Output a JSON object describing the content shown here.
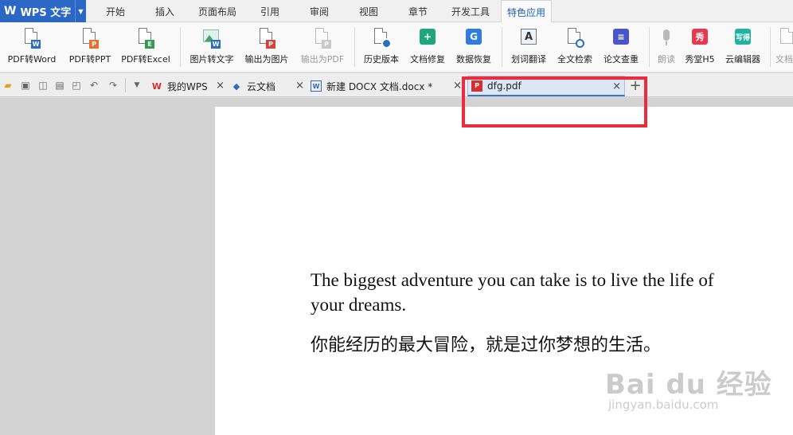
{
  "app": {
    "title": "WPS 文字"
  },
  "menu_tabs": [
    "开始",
    "插入",
    "页面布局",
    "引用",
    "审阅",
    "视图",
    "章节",
    "开发工具",
    "特色应用"
  ],
  "ribbon": {
    "buttons": [
      {
        "label": "PDF转Word",
        "icon": "pdf-to-word-icon",
        "badge": "W",
        "color": "#2b6cc4"
      },
      {
        "label": "PDF转PPT",
        "icon": "pdf-to-ppt-icon",
        "badge": "P",
        "color": "#e8702a"
      },
      {
        "label": "PDF转Excel",
        "icon": "pdf-to-excel-icon",
        "badge": "E",
        "color": "#2f9e4f"
      },
      {
        "label": "图片转文字",
        "icon": "image-to-text-icon",
        "badge": "W",
        "color": "#2b6cc4"
      },
      {
        "label": "输出为图片",
        "icon": "export-image-icon",
        "badge": "P",
        "color": "#d9413a"
      },
      {
        "label": "输出为PDF",
        "icon": "export-pdf-icon",
        "badge": "P",
        "color": "#9a9a9a"
      },
      {
        "label": "历史版本",
        "icon": "history-version-icon",
        "badge": "",
        "color": "#2b6cc4"
      },
      {
        "label": "文档修复",
        "icon": "doc-repair-icon",
        "badge": "+",
        "color": "#1fa67a"
      },
      {
        "label": "数据恢复",
        "icon": "data-recovery-icon",
        "badge": "G",
        "color": "#2f7de1"
      },
      {
        "label": "划词翻译",
        "icon": "word-translate-icon",
        "badge": "A",
        "color": "#555555"
      },
      {
        "label": "全文检索",
        "icon": "fulltext-search-icon",
        "badge": "",
        "color": "#2b6cc4"
      },
      {
        "label": "论文查重",
        "icon": "paper-check-icon",
        "badge": "",
        "color": "#4a55c8"
      },
      {
        "label": "朗读",
        "icon": "read-aloud-icon",
        "badge": "",
        "color": "#9a9a9a"
      },
      {
        "label": "秀堂H5",
        "icon": "xiutang-h5-icon",
        "badge": "秀",
        "color": "#e8384f"
      },
      {
        "label": "云编辑器",
        "icon": "cloud-editor-icon",
        "badge": "写得",
        "color": "#22b2a0"
      },
      {
        "label": "文档",
        "icon": "doc-more-icon",
        "badge": "",
        "color": "#9a9a9a"
      }
    ]
  },
  "doc_tabs": [
    {
      "label": "我的WPS",
      "icon": "wps-logo-icon"
    },
    {
      "label": "云文档",
      "icon": "cloud-doc-icon"
    },
    {
      "label": "新建 DOCX 文档.docx *",
      "icon": "docx-file-icon"
    },
    {
      "label": "dfg.pdf",
      "icon": "pdf-file-icon"
    }
  ],
  "document": {
    "english": "The biggest adventure you can take is to live the life of your dreams.",
    "chinese": "你能经历的最大冒险，就是过你梦想的生活。"
  },
  "watermark": {
    "brand": "Bai du 经验",
    "url": "jingyan.baidu.com"
  },
  "colors": {
    "brand_blue": "#2b68c6",
    "highlight_red": "#ec2c3c",
    "active_tab_text": "#1f5fc0"
  }
}
